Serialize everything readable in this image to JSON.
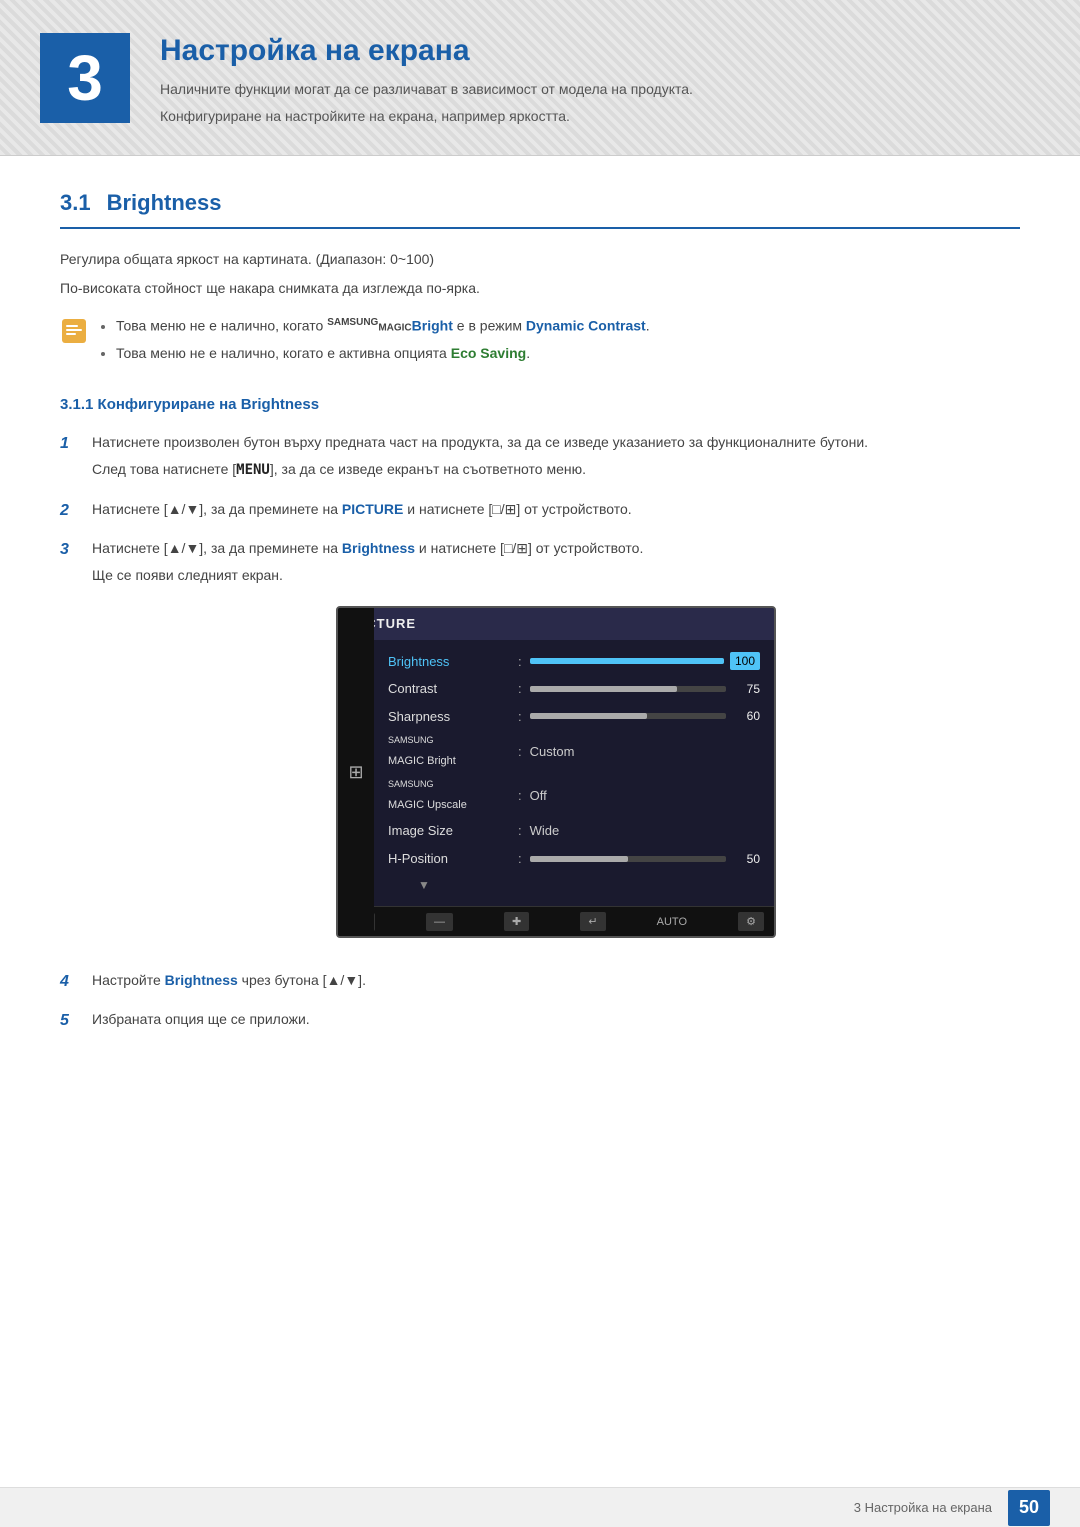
{
  "header": {
    "chapter_num": "3",
    "chapter_title": "Настройка на екрана",
    "desc1": "Наличните функции могат да се различават в зависимост от модела на продукта.",
    "desc2": "Конфигуриране на настройките на екрана, например яркостта."
  },
  "section_31": {
    "number": "3.1",
    "title": "Brightness",
    "desc1": "Регулира общата яркост на картината. (Диапазон: 0~100)",
    "desc2": "По-високата стойност ще накара снимката да изглежда по-ярка.",
    "notes": [
      "Това меню не е налично, когато SAMSUNGMAGIC Bright е в режим Dynamic Contrast.",
      "Това меню не е налично, когато е активна опцията Eco Saving."
    ],
    "note_dynamic": "Dynamic Contrast",
    "note_eco": "Eco Saving",
    "note_samsung": "SAMSUNG",
    "note_magic": "MAGIC",
    "note_bright": "Bright"
  },
  "subsection_311": {
    "number": "3.1.1",
    "title": "Конфигуриране на Brightness"
  },
  "steps": [
    {
      "num": "1",
      "text1": "Натиснете произволен бутон върху предната част на продукта, за да се изведе указанието за функционалните бутони.",
      "text2": "След това натиснете [MENU], за да се изведе екранът на съответното меню."
    },
    {
      "num": "2",
      "text": "Натиснете [▲/▼], за да преминете на PICTURE и натиснете [□/⊞] от устройството."
    },
    {
      "num": "3",
      "text1": "Натиснете [▲/▼], за да преминете на Brightness и натиснете [□/⊞] от устройството.",
      "text2": "Ще се появи следният екран."
    },
    {
      "num": "4",
      "text": "Настройте Brightness чрез бутона [▲/▼]."
    },
    {
      "num": "5",
      "text": "Избраната опция ще се приложи."
    }
  ],
  "screen": {
    "header": "PICTURE",
    "rows": [
      {
        "label": "Brightness",
        "type": "bar",
        "fill": 100,
        "val": "100",
        "highlighted": true
      },
      {
        "label": "Contrast",
        "type": "bar",
        "fill": 75,
        "val": "75",
        "highlighted": false
      },
      {
        "label": "Sharpness",
        "type": "bar",
        "fill": 60,
        "val": "60",
        "highlighted": false
      },
      {
        "label": "SAMSUNG MAGIC Bright",
        "type": "text",
        "val": "Custom",
        "highlighted": false
      },
      {
        "label": "SAMSUNG MAGIC Upscale",
        "type": "text",
        "val": "Off",
        "highlighted": false
      },
      {
        "label": "Image Size",
        "type": "text",
        "val": "Wide",
        "highlighted": false
      },
      {
        "label": "H-Position",
        "type": "bar",
        "fill": 50,
        "val": "50",
        "highlighted": false
      }
    ],
    "footer_buttons": [
      "◄",
      "—",
      "✚",
      "↵",
      "AUTO",
      "⚙"
    ]
  },
  "footer": {
    "chapter_label": "3 Настройка на екрана",
    "page_num": "50"
  }
}
